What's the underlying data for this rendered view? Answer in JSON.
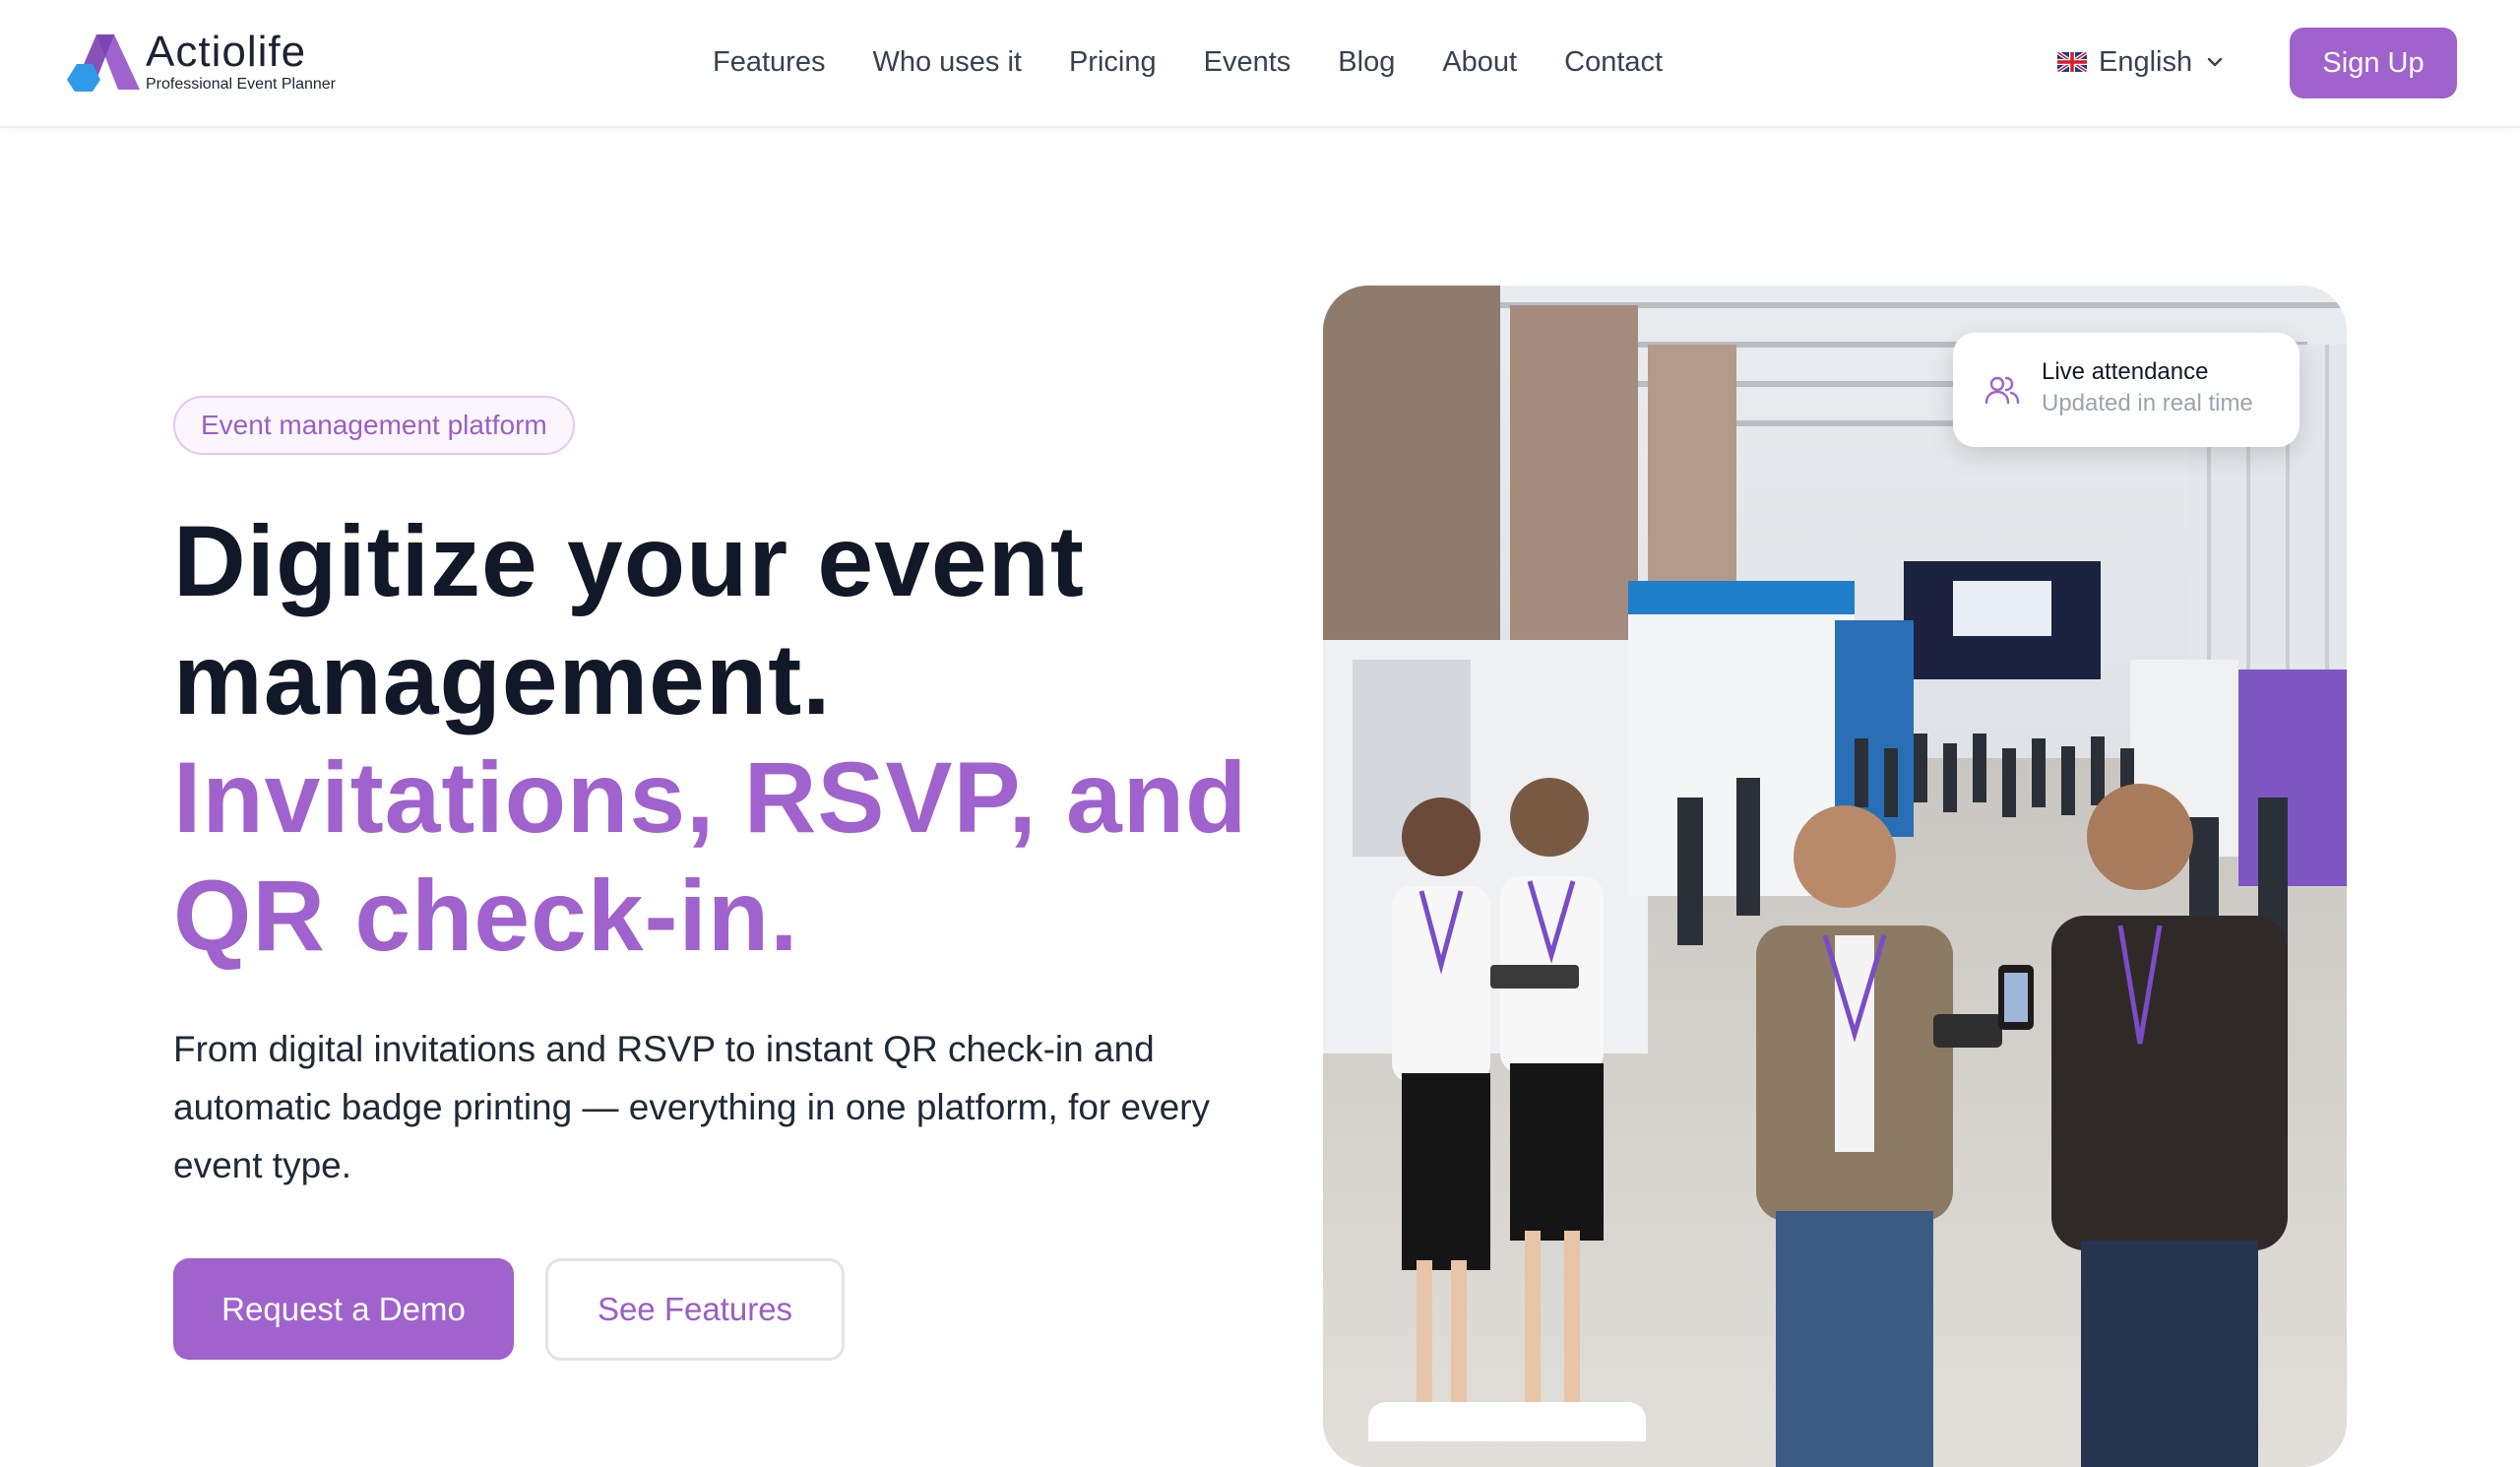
{
  "brand": {
    "name": "Actiolife",
    "tagline": "Professional Event Planner"
  },
  "nav": {
    "items": [
      "Features",
      "Who uses it",
      "Pricing",
      "Events",
      "Blog",
      "About",
      "Contact"
    ],
    "language": "English",
    "language_icon": "uk-flag-icon",
    "signup_label": "Sign Up"
  },
  "hero": {
    "badge": "Event management platform",
    "headline_dark": [
      "Digitize your event",
      "management."
    ],
    "headline_accent": [
      "Invitations, RSVP, and",
      "QR check-in."
    ],
    "description": "From digital invitations and RSVP to instant QR check-in and automatic badge printing — everything in one platform, for every event type.",
    "primary_cta": "Request a Demo",
    "secondary_cta": "See Features"
  },
  "live_card": {
    "title": "Live attendance",
    "subtitle": "Updated in real time",
    "icon": "users-icon"
  },
  "colors": {
    "accent": "#a062cc",
    "text_dark": "#111827",
    "text_body": "#1f2937",
    "nav_text": "#374151"
  }
}
